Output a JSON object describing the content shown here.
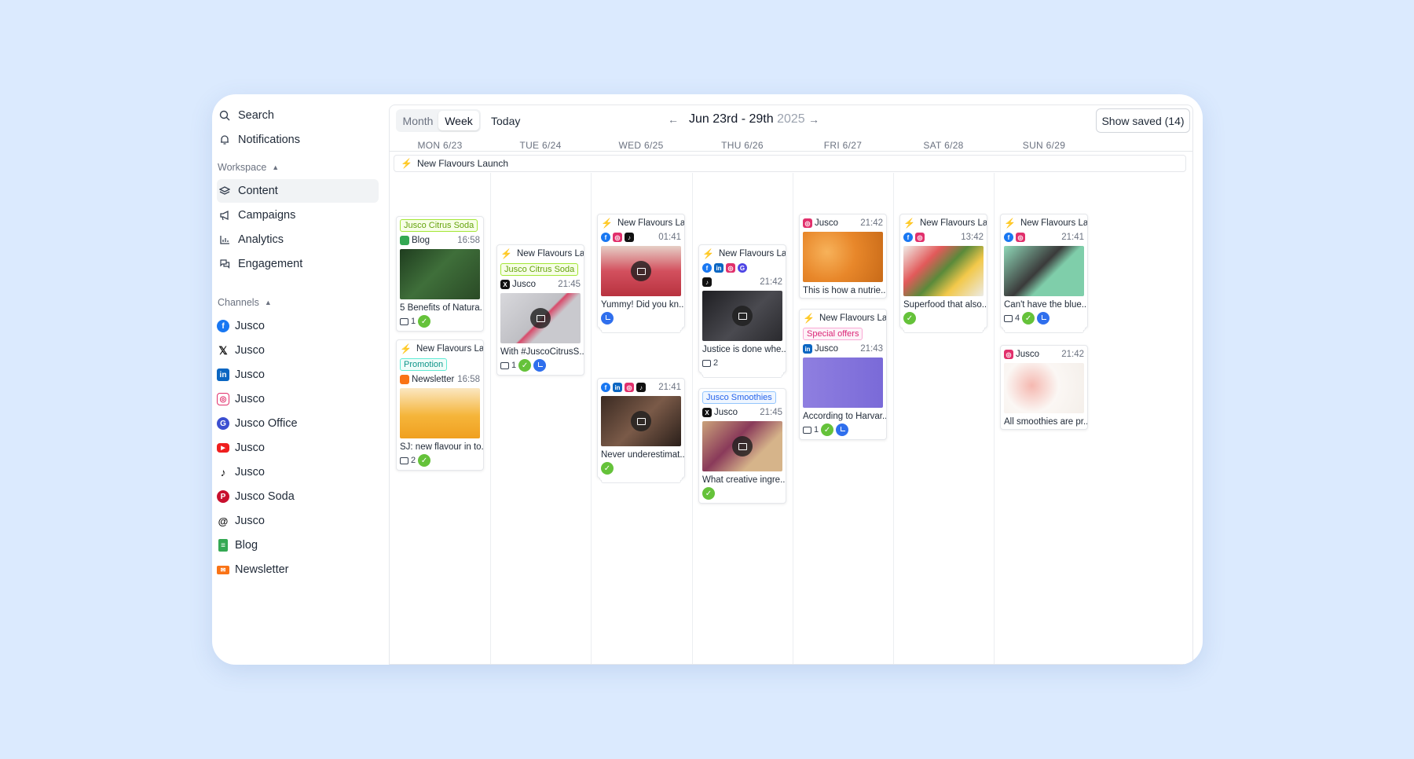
{
  "sidebar": {
    "top": [
      {
        "label": "Search",
        "icon": "search-icon"
      },
      {
        "label": "Notifications",
        "icon": "bell-icon"
      }
    ],
    "workspace_label": "Workspace",
    "workspace": [
      {
        "label": "Content",
        "icon": "layers-icon",
        "active": true
      },
      {
        "label": "Campaigns",
        "icon": "megaphone-icon"
      },
      {
        "label": "Analytics",
        "icon": "bar-chart-icon"
      },
      {
        "label": "Engagement",
        "icon": "chat-icon"
      }
    ],
    "channels_label": "Channels",
    "channels": [
      {
        "label": "Jusco",
        "icon": "facebook-icon"
      },
      {
        "label": "Jusco",
        "icon": "x-icon"
      },
      {
        "label": "Jusco",
        "icon": "linkedin-icon"
      },
      {
        "label": "Jusco",
        "icon": "instagram-icon"
      },
      {
        "label": "Jusco Office",
        "icon": "google-business-icon"
      },
      {
        "label": "Jusco",
        "icon": "youtube-icon"
      },
      {
        "label": "Jusco",
        "icon": "tiktok-icon"
      },
      {
        "label": "Jusco Soda",
        "icon": "pinterest-icon"
      },
      {
        "label": "Jusco",
        "icon": "threads-icon"
      },
      {
        "label": "Blog",
        "icon": "blog-icon"
      },
      {
        "label": "Newsletter",
        "icon": "newsletter-icon"
      }
    ]
  },
  "toolbar": {
    "month": "Month",
    "week": "Week",
    "today": "Today",
    "range": "Jun 23rd - 29th",
    "year": "2025",
    "prev": "←",
    "next": "→",
    "show_saved": "Show saved (14)"
  },
  "days": [
    "MON 6/23",
    "TUE 6/24",
    "WED 6/25",
    "THU 6/26",
    "FRI 6/27",
    "SAT 6/28",
    "SUN 6/29"
  ],
  "allday_event": "New Flavours Launch",
  "cards": {
    "mon1": {
      "tag": "Jusco Citrus Soda",
      "channel": "Blog",
      "time": "16:58",
      "caption": "5 Benefits of Natura...",
      "comments": "1"
    },
    "mon2": {
      "campaign": "New Flavours La...",
      "tag": "Promotion",
      "channel": "Newsletter",
      "time": "16:58",
      "caption": "SJ: new flavour in to...",
      "comments": "2"
    },
    "tue1": {
      "campaign": "New Flavours La...",
      "tag": "Jusco Citrus Soda",
      "channel": "Jusco",
      "time": "21:45",
      "caption": "With #JuscoCitrusS...",
      "comments": "1"
    },
    "wed1": {
      "campaign": "New Flavours La...",
      "time": "01:41",
      "caption": "Yummy! Did you kn..."
    },
    "wed2": {
      "time": "21:41",
      "caption": "Never underestimat..."
    },
    "thu1": {
      "campaign": "New Flavours La...",
      "time": "21:42",
      "caption": "Justice is done whe...",
      "comments": "2"
    },
    "thu2": {
      "tag": "Jusco Smoothies",
      "channel": "Jusco",
      "time": "21:45",
      "caption": "What creative ingre..."
    },
    "fri1": {
      "channel": "Jusco",
      "time": "21:42",
      "caption": "This is how a nutrie..."
    },
    "fri2": {
      "campaign": "New Flavours La...",
      "tag": "Special offers",
      "channel": "Jusco",
      "time": "21:43",
      "caption": "According to Harvar...",
      "comments": "1"
    },
    "sat1": {
      "campaign": "New Flavours La...",
      "time": "13:42",
      "caption": "Superfood that also..."
    },
    "sun1": {
      "campaign": "New Flavours La...",
      "time": "21:41",
      "caption": "Can't have the blue...",
      "comments": "4"
    },
    "sun2": {
      "channel": "Jusco",
      "time": "21:42",
      "caption": "All smoothies are pr..."
    }
  },
  "colors": {
    "accent": "#2f6fed",
    "approved": "#65c23a",
    "background": "#dbeafe"
  }
}
